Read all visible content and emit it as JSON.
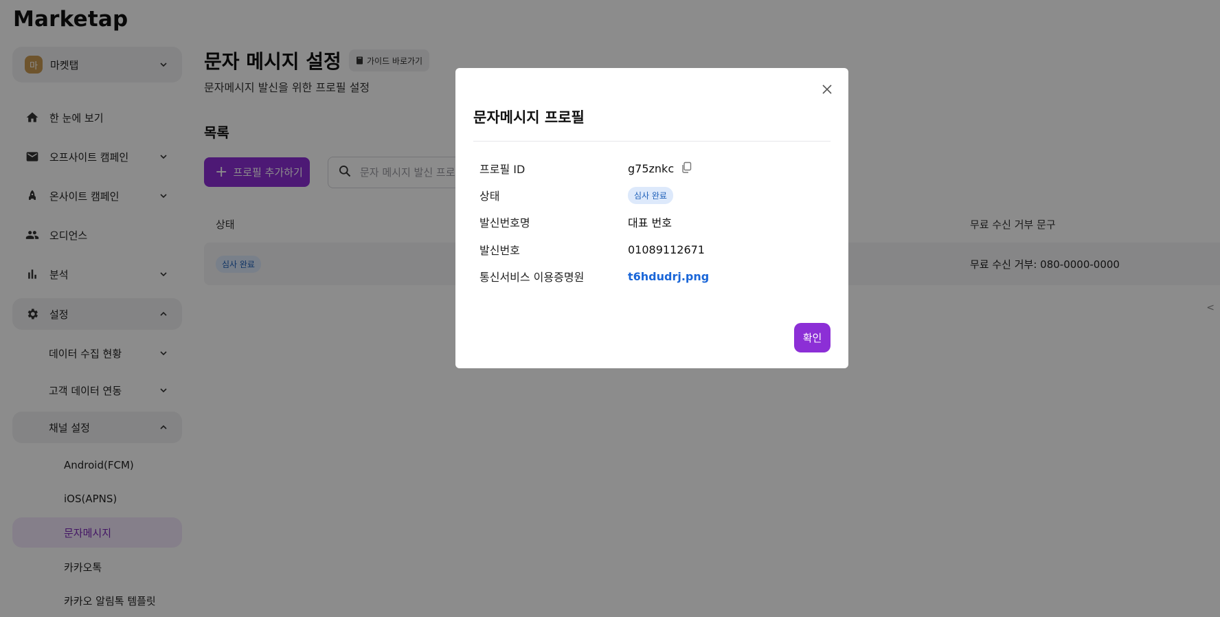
{
  "app": {
    "logo": "Marketap"
  },
  "sidebar": {
    "org": {
      "avatar": "마",
      "name": "마켓탭"
    },
    "items": [
      {
        "label": "한 눈에 보기",
        "icon": "home-icon"
      },
      {
        "label": "오프사이트 캠페인",
        "icon": "mail-icon"
      },
      {
        "label": "온사이트 캠페인",
        "icon": "rocket-icon"
      },
      {
        "label": "오디언스",
        "icon": "people-icon"
      },
      {
        "label": "분석",
        "icon": "bar-chart-icon"
      },
      {
        "label": "설정",
        "icon": "gear-icon"
      }
    ],
    "settings_sub": [
      {
        "label": "데이터 수집 현황"
      },
      {
        "label": "고객 데이터 연동"
      },
      {
        "label": "채널 설정"
      }
    ],
    "channel_leaves": [
      {
        "label": "Android(FCM)"
      },
      {
        "label": "iOS(APNS)"
      },
      {
        "label": "문자메시지"
      },
      {
        "label": "카카오톡"
      },
      {
        "label": "카카오 알림톡 템플릿"
      }
    ]
  },
  "main": {
    "title": "문자 메시지 설정",
    "guide_label": "가이드 바로가기",
    "subtitle": "문자메시지 발신을 위한 프로필 설정",
    "section_title": "목록",
    "add_button": "프로필 추가하기",
    "search_placeholder": "문자 메시지 발신 프로필",
    "table": {
      "headers": {
        "status": "상태",
        "optout": "무료 수신 거부 문구"
      },
      "rows": [
        {
          "status": "심사 완료",
          "optout": "무료 수신 거부: 080-0000-0000"
        }
      ]
    }
  },
  "modal": {
    "title": "문자메시지 프로필",
    "fields": [
      {
        "key": "프로필 ID",
        "value": "g75znkc"
      },
      {
        "key": "상태",
        "value": "심사 완료"
      },
      {
        "key": "발신번호명",
        "value": "대표 번호"
      },
      {
        "key": "발신번호",
        "value": "01089112671"
      },
      {
        "key": "통신서비스 이용증명원",
        "value": "t6hdudrj.png"
      }
    ],
    "confirm": "확인"
  },
  "colors": {
    "brand": "#8c2fd6",
    "link": "#1a66d8",
    "badge_bg": "#dde9fb",
    "badge_text": "#1d5fb8"
  }
}
